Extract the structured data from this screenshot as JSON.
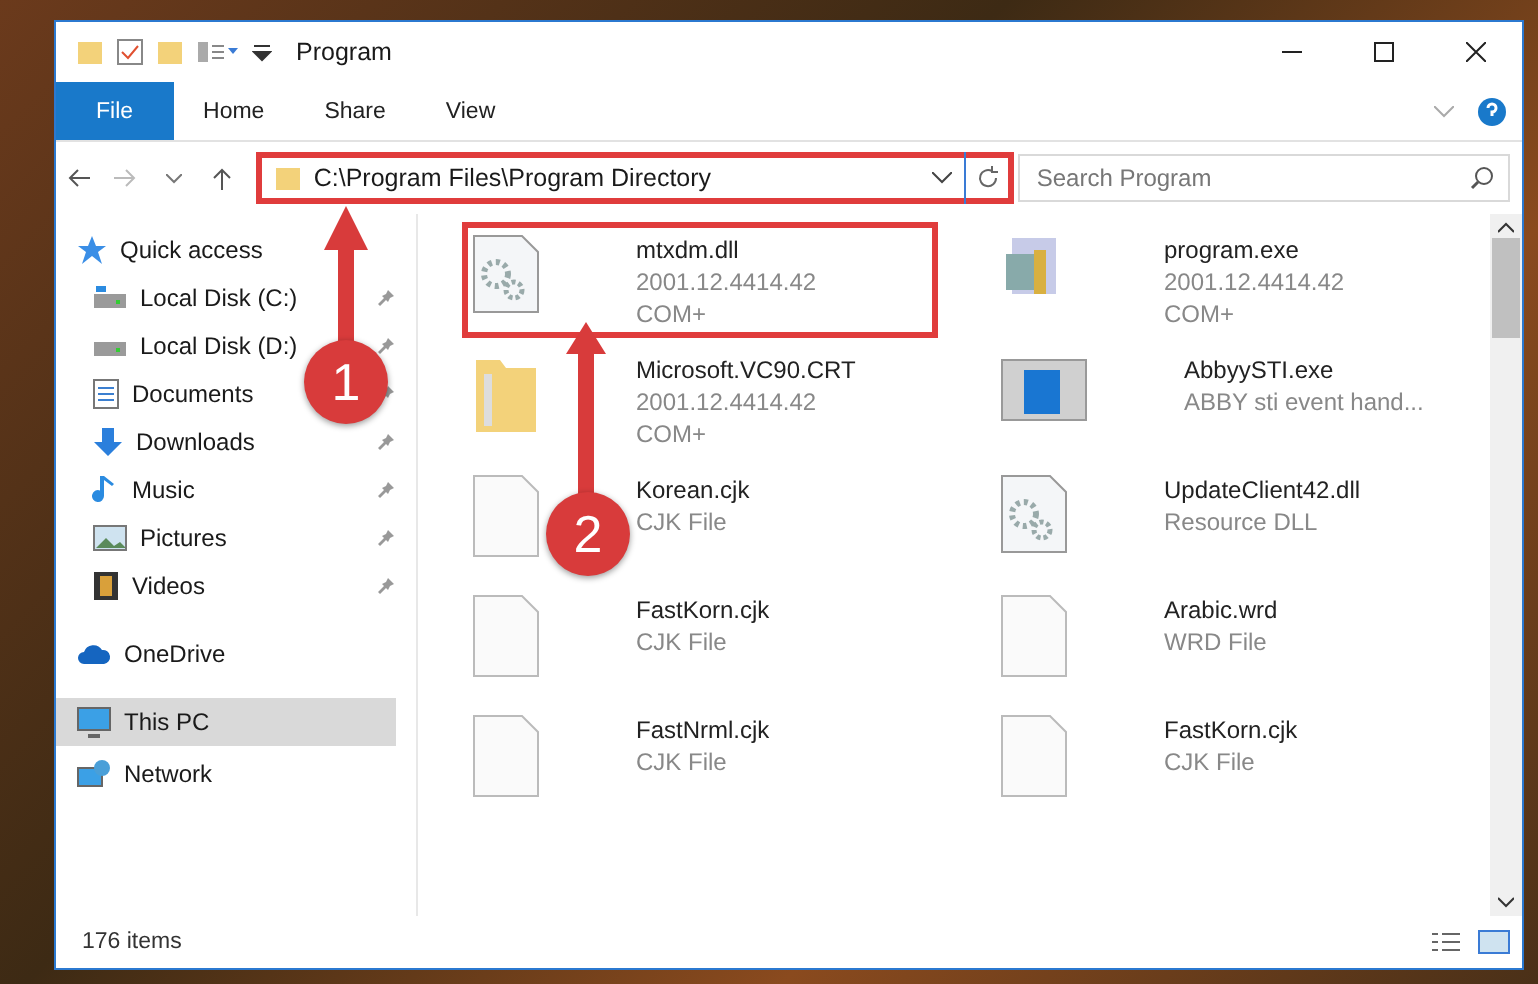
{
  "window": {
    "title": "Program"
  },
  "ribbon_tabs": [
    {
      "label": "File",
      "selected": true
    },
    {
      "label": "Home",
      "selected": false
    },
    {
      "label": "Share",
      "selected": false
    },
    {
      "label": "View",
      "selected": false
    }
  ],
  "address": {
    "path": "C:\\Program Files\\Program Directory",
    "highlighted": true
  },
  "search": {
    "placeholder": "Search Program"
  },
  "sidebar": {
    "items": [
      {
        "label": "Quick access",
        "kind": "star",
        "selected": false,
        "children": [
          {
            "label": "Local Disk (C:)",
            "kind": "drive-c",
            "pinned": true,
            "selected": false
          },
          {
            "label": "Local Disk (D:)",
            "kind": "drive",
            "pinned": true,
            "selected": false
          },
          {
            "label": "Documents",
            "kind": "document",
            "pinned": true,
            "selected": false
          },
          {
            "label": "Downloads",
            "kind": "download",
            "pinned": true,
            "selected": false
          },
          {
            "label": "Music",
            "kind": "music",
            "pinned": true,
            "selected": false
          },
          {
            "label": "Pictures",
            "kind": "picture",
            "pinned": true,
            "selected": false
          },
          {
            "label": "Videos",
            "kind": "video",
            "pinned": true,
            "selected": false
          }
        ]
      },
      {
        "label": "OneDrive",
        "kind": "cloud",
        "selected": false
      },
      {
        "label": "This PC",
        "kind": "pc",
        "selected": true
      },
      {
        "label": "Network",
        "kind": "network",
        "selected": false
      }
    ]
  },
  "files": [
    {
      "name": "mtxdm.dll",
      "details": [
        "2001.12.4414.42",
        "COM+"
      ],
      "kind": "gear-file",
      "highlighted": true
    },
    {
      "name": "program.exe",
      "details": [
        "2001.12.4414.42",
        "COM+"
      ],
      "kind": "installer",
      "highlighted": false
    },
    {
      "name": "Microsoft.VC90.CRT",
      "details": [
        "2001.12.4414.42",
        "COM+"
      ],
      "kind": "folder",
      "highlighted": false
    },
    {
      "name": "AbbyySTI.exe",
      "details": [
        "ABBY sti event hand..."
      ],
      "kind": "window",
      "highlighted": false
    },
    {
      "name": "Korean.cjk",
      "details": [
        "CJK File"
      ],
      "kind": "blank",
      "highlighted": false
    },
    {
      "name": "UpdateClient42.dll",
      "details": [
        "Resource DLL"
      ],
      "kind": "gear-file",
      "highlighted": false
    },
    {
      "name": "FastKorn.cjk",
      "details": [
        "CJK File"
      ],
      "kind": "blank",
      "highlighted": false
    },
    {
      "name": "Arabic.wrd",
      "details": [
        "WRD File"
      ],
      "kind": "blank",
      "highlighted": false
    },
    {
      "name": "FastNrml.cjk",
      "details": [
        "CJK File"
      ],
      "kind": "blank",
      "highlighted": false
    },
    {
      "name": "FastKorn.cjk",
      "details": [
        "CJK File"
      ],
      "kind": "blank",
      "highlighted": false
    }
  ],
  "callouts": [
    {
      "number": "1"
    },
    {
      "number": "2"
    }
  ],
  "status_bar": {
    "item_count": "176 items"
  }
}
